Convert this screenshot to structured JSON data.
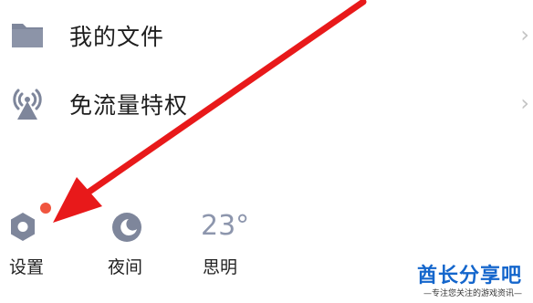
{
  "menu": {
    "items": [
      {
        "label": "我的文件",
        "icon": "folder-icon"
      },
      {
        "label": "免流量特权",
        "icon": "signal-tower-icon"
      }
    ],
    "chevron": "›"
  },
  "bottom_bar": {
    "settings": {
      "label": "设置",
      "icon": "gear-icon",
      "has_notification_dot": true
    },
    "night": {
      "label": "夜间",
      "icon": "moon-icon"
    },
    "weather": {
      "temperature": "23°",
      "city": "思明"
    }
  },
  "watermark": {
    "title": "酋长分享吧",
    "subtitle": "—专注您关注的游戏资讯—"
  },
  "colors": {
    "icon_gray": "#7e869b",
    "arrow_red": "#e8191a",
    "dot_red": "#f0553f",
    "watermark_blue": "#1466cc"
  }
}
